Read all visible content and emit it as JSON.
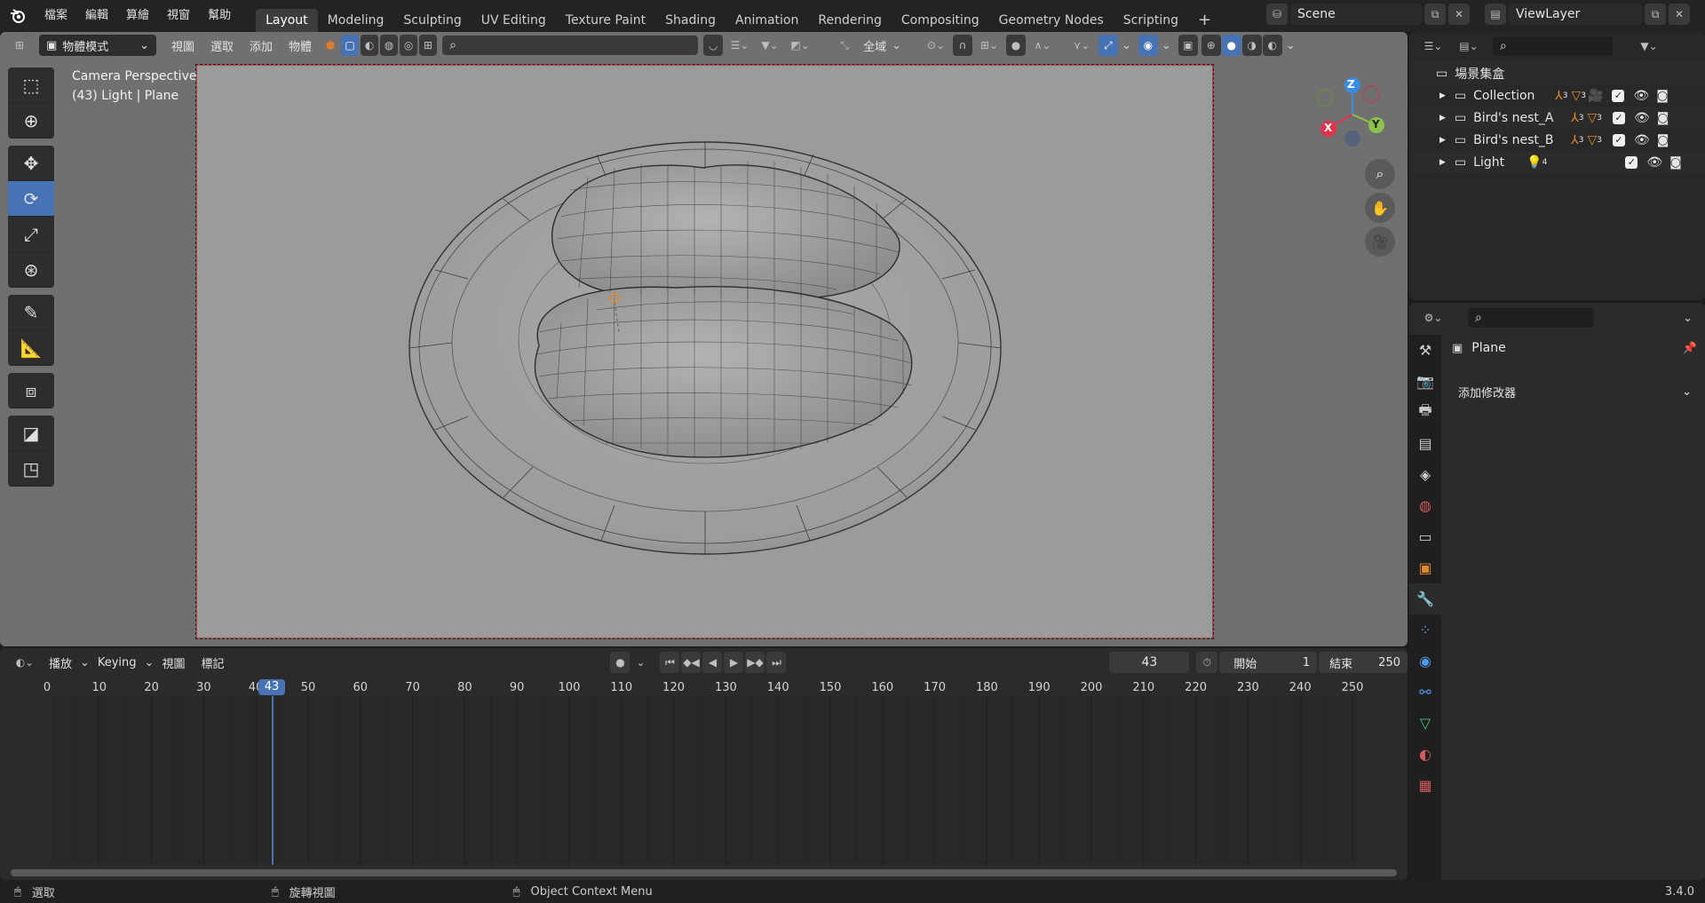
{
  "top_menu": [
    "檔案",
    "編輯",
    "算繪",
    "視窗",
    "幫助"
  ],
  "workspaces": [
    "Layout",
    "Modeling",
    "Sculpting",
    "UV Editing",
    "Texture Paint",
    "Shading",
    "Animation",
    "Rendering",
    "Compositing",
    "Geometry Nodes",
    "Scripting"
  ],
  "active_workspace": "Layout",
  "scene_name": "Scene",
  "view_layer_name": "ViewLayer",
  "viewport_header": {
    "mode": "物體模式",
    "menus": [
      "視圖",
      "選取",
      "添加",
      "物體"
    ],
    "transform_orientation": "全域"
  },
  "viewport_overlay": {
    "line1": "Camera Perspective",
    "line2": "(43) Light | Plane"
  },
  "gizmo": {
    "z": "Z",
    "x": "X",
    "y": "Y"
  },
  "outliner": {
    "root": "場景集盒",
    "items": [
      {
        "name": "Collection",
        "badge1": "3",
        "badge2": "3"
      },
      {
        "name": "Bird's nest_A",
        "badge1": "3",
        "badge2": "3"
      },
      {
        "name": "Bird's nest_B",
        "badge1": "3",
        "badge2": "3"
      },
      {
        "name": "Light",
        "badge1": "4",
        "badge2": ""
      }
    ]
  },
  "properties": {
    "object_name": "Plane",
    "add_modifier": "添加修改器"
  },
  "timeline": {
    "menus": [
      "播放",
      "Keying",
      "視圖",
      "標記"
    ],
    "current_frame": "43",
    "start_label": "開始",
    "start_value": "1",
    "end_label": "結束",
    "end_value": "250",
    "ticks": [
      "0",
      "10",
      "20",
      "30",
      "40",
      "50",
      "60",
      "70",
      "80",
      "90",
      "100",
      "110",
      "120",
      "130",
      "140",
      "150",
      "160",
      "170",
      "180",
      "190",
      "200",
      "210",
      "220",
      "230",
      "240",
      "250"
    ]
  },
  "status_bar": {
    "select": "選取",
    "rotate_view": "旋轉視圖",
    "context_menu": "Object Context Menu",
    "version": "3.4.0"
  },
  "colors": {
    "accent": "#4772b3",
    "frame_border": "#b74444",
    "axis_x": "#e2334b",
    "axis_y": "#8bc34a",
    "axis_z": "#3a8ce3"
  }
}
